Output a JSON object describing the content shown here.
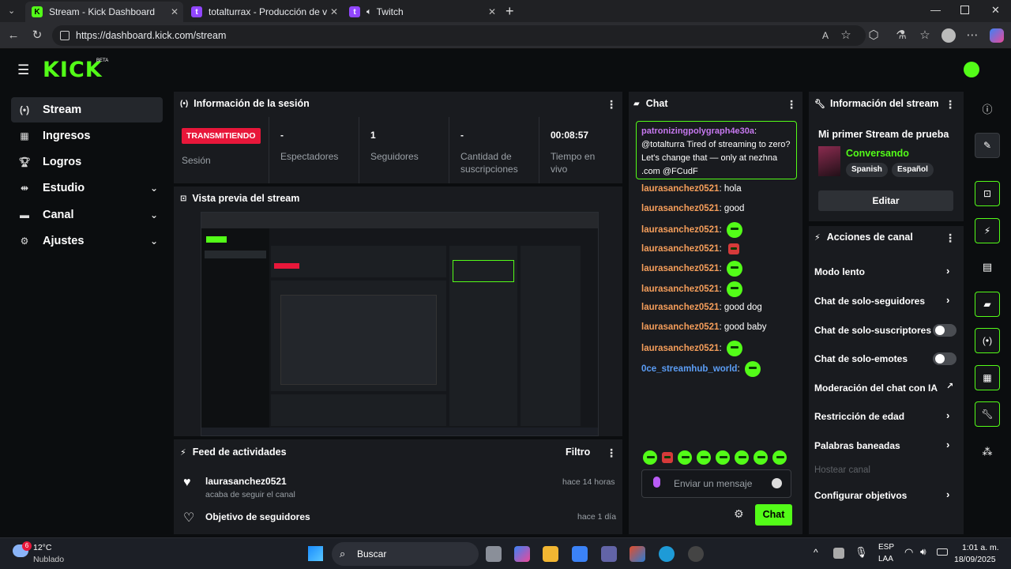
{
  "browser": {
    "tabs": [
      {
        "title": "Stream - Kick Dashboard",
        "active": true
      },
      {
        "title": "totalturrax - Producción de vídeo",
        "active": false
      },
      {
        "title": "Twitch",
        "active": false
      }
    ],
    "url": "https://dashboard.kick.com/stream"
  },
  "app": {
    "logo": "KICK",
    "logo_badge": "BETA",
    "brand_color": "#53fc18"
  },
  "sidebar": {
    "items": [
      {
        "label": "Stream",
        "icon": "stream-icon",
        "active": true
      },
      {
        "label": "Ingresos",
        "icon": "income-icon"
      },
      {
        "label": "Logros",
        "icon": "trophy-icon"
      },
      {
        "label": "Estudio",
        "icon": "studio-icon",
        "expandable": true
      },
      {
        "label": "Canal",
        "icon": "channel-icon",
        "expandable": true
      },
      {
        "label": "Ajustes",
        "icon": "gear-icon",
        "expandable": true
      }
    ]
  },
  "session": {
    "title": "Información de la sesión",
    "status": "TRANSMITIENDO",
    "status_label": "Sesión",
    "stats": [
      {
        "value": "-",
        "label": "Espectadores"
      },
      {
        "value": "1",
        "label": "Seguidores"
      },
      {
        "value": "-",
        "label": "Cantidad de suscripciones"
      },
      {
        "value": "00:08:57",
        "label": "Tiempo en vivo"
      }
    ]
  },
  "preview": {
    "title": "Vista previa del stream"
  },
  "feed": {
    "title": "Feed de actividades",
    "filter": "Filtro",
    "items": [
      {
        "user": "laurasanchez0521",
        "text": "acaba de seguir el canal",
        "time": "hace 14 horas"
      },
      {
        "user": "Objetivo de seguidores",
        "text": "",
        "time": "hace 1 día"
      }
    ]
  },
  "chat": {
    "title": "Chat",
    "pinned": {
      "user": "patronizingpolygraph4e30a",
      "text": "@totalturra Tired of streaming to zero? Let's change that — only at nezhna .com @FCudF"
    },
    "messages": [
      {
        "user": "laurasanchez0521",
        "text": "hola"
      },
      {
        "user": "laurasanchez0521",
        "text": "good"
      },
      {
        "user": "laurasanchez0521",
        "text": "",
        "emote": "green"
      },
      {
        "user": "laurasanchez0521",
        "text": "",
        "emote": "red"
      },
      {
        "user": "laurasanchez0521",
        "text": "",
        "emote": "green"
      },
      {
        "user": "laurasanchez0521",
        "text": "",
        "emote": "green"
      },
      {
        "user": "laurasanchez0521",
        "text": "good dog"
      },
      {
        "user": "laurasanchez0521",
        "text": "good baby"
      },
      {
        "user": "laurasanchez0521",
        "text": "",
        "emote": "green"
      },
      {
        "user": "0ce_streamhub_world",
        "text": "",
        "emote": "green",
        "color": "#5b9df5"
      }
    ],
    "placeholder": "Enviar un mensaje",
    "send_label": "Chat"
  },
  "stream_info": {
    "title": "Información del stream",
    "stream_title": "Mi primer Stream de prueba",
    "category": "Conversando",
    "tags": [
      "Spanish",
      "Español"
    ],
    "edit_label": "Editar"
  },
  "channel_actions": {
    "title": "Acciones de canal",
    "items": [
      {
        "label": "Modo lento",
        "control": "chevron"
      },
      {
        "label": "Chat de solo-seguidores",
        "control": "chevron"
      },
      {
        "label": "Chat de solo-suscriptores",
        "control": "toggle"
      },
      {
        "label": "Chat de solo-emotes",
        "control": "toggle"
      },
      {
        "label": "Moderación del chat con IA",
        "control": "external"
      },
      {
        "label": "Restricción de edad",
        "control": "chevron"
      },
      {
        "label": "Palabras baneadas",
        "control": "chevron"
      },
      {
        "label": "Hostear canal",
        "control": "disabled"
      },
      {
        "label": "Configurar objetivos",
        "control": "chevron"
      }
    ]
  },
  "taskbar": {
    "weather_temp": "12°C",
    "weather_text": "Nublado",
    "weather_badge": "6",
    "search": "Buscar",
    "lang": "ESP",
    "lang2": "LAA",
    "time": "1:01 a. m.",
    "date": "18/09/2025"
  }
}
